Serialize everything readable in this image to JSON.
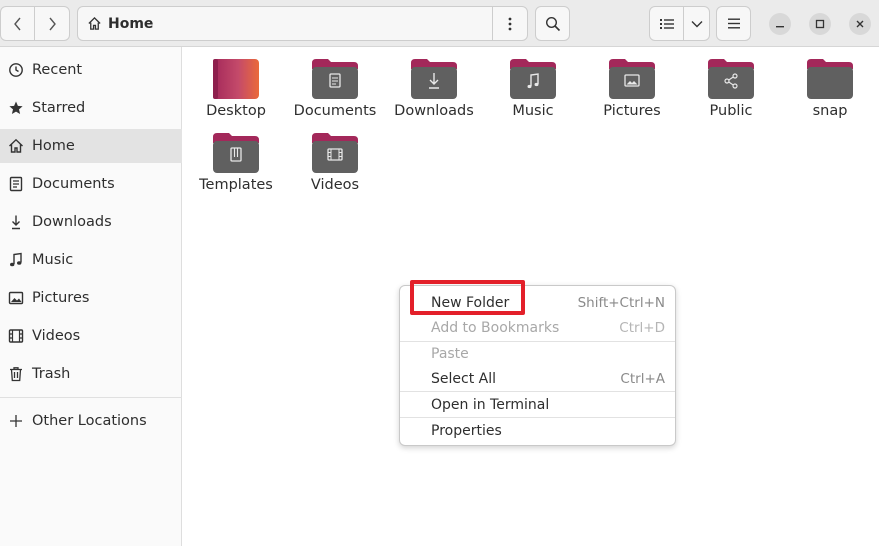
{
  "window": {
    "path_label": "Home"
  },
  "sidebar": {
    "items": [
      {
        "label": "Recent",
        "icon": "clock-icon"
      },
      {
        "label": "Starred",
        "icon": "star-icon"
      },
      {
        "label": "Home",
        "icon": "home-icon",
        "active": true
      },
      {
        "label": "Documents",
        "icon": "document-icon"
      },
      {
        "label": "Downloads",
        "icon": "download-icon"
      },
      {
        "label": "Music",
        "icon": "music-note-icon"
      },
      {
        "label": "Pictures",
        "icon": "picture-icon"
      },
      {
        "label": "Videos",
        "icon": "film-icon"
      },
      {
        "label": "Trash",
        "icon": "trash-icon"
      },
      {
        "label": "Other Locations",
        "icon": "plus-icon"
      }
    ]
  },
  "folders": [
    {
      "label": "Desktop",
      "icon": "desktop-folder-icon"
    },
    {
      "label": "Documents",
      "icon": "documents-folder-icon"
    },
    {
      "label": "Downloads",
      "icon": "downloads-folder-icon"
    },
    {
      "label": "Music",
      "icon": "music-folder-icon"
    },
    {
      "label": "Pictures",
      "icon": "pictures-folder-icon"
    },
    {
      "label": "Public",
      "icon": "public-folder-icon"
    },
    {
      "label": "snap",
      "icon": "folder-icon"
    },
    {
      "label": "Templates",
      "icon": "templates-folder-icon"
    },
    {
      "label": "Videos",
      "icon": "videos-folder-icon"
    }
  ],
  "context_menu": {
    "items": [
      {
        "label": "New Folder",
        "shortcut": "Shift+Ctrl+N",
        "enabled": true
      },
      {
        "label": "Add to Bookmarks",
        "shortcut": "Ctrl+D",
        "enabled": false
      },
      {
        "label": "Paste",
        "shortcut": "",
        "enabled": false
      },
      {
        "label": "Select All",
        "shortcut": "Ctrl+A",
        "enabled": true
      },
      {
        "label": "Open in Terminal",
        "shortcut": "",
        "enabled": true
      },
      {
        "label": "Properties",
        "shortcut": "",
        "enabled": true
      }
    ]
  },
  "colors": {
    "folder_top": "#a3285a",
    "folder_body": "#606060",
    "desktop_gradient_start": "#a3285a",
    "desktop_gradient_end": "#ea6a3a",
    "highlight_border": "#e3202a"
  }
}
